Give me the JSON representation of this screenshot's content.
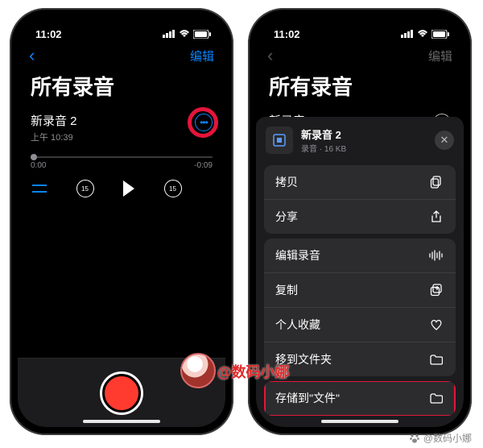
{
  "status": {
    "time": "11:02",
    "duration_neg": "-0:09",
    "duration_start": "0:00"
  },
  "header": {
    "edit": "编辑"
  },
  "title": "所有录音",
  "recording": {
    "name": "新录音 2",
    "time": "上午 10:39"
  },
  "controls": {
    "skip": "15"
  },
  "sheet": {
    "title": "新录音 2",
    "sub": "录音 · 16 KB",
    "actions": {
      "copy": "拷贝",
      "share": "分享",
      "edit": "编辑录音",
      "duplicate": "复制",
      "favorite": "个人收藏",
      "moveFolder": "移到文件夹",
      "saveFiles": "存储到\"文件\""
    }
  },
  "watermark": {
    "handle": "@数码小娜",
    "footer": "@数码小娜"
  }
}
